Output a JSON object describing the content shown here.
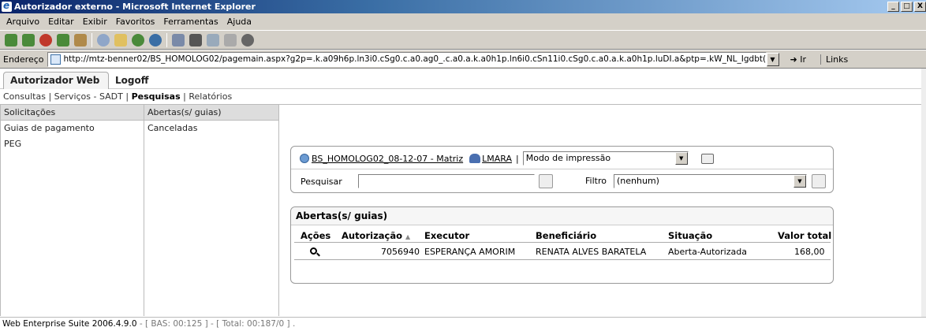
{
  "window": {
    "title": "Autorizador externo - Microsoft Internet Explorer",
    "buttons": [
      "_",
      "□",
      "X"
    ]
  },
  "menu": [
    "Arquivo",
    "Editar",
    "Exibir",
    "Favoritos",
    "Ferramentas",
    "Ajuda"
  ],
  "address": {
    "label": "Endereço",
    "url": "http://mtz-benner02/BS_HOMOLOG02/pagemain.aspx?g2p=.k.a09h6p.ln3i0.cSg0.c.a0.ag0_.c.a0.a.k.a0h1p.ln6i0.cSn11i0.cSg0.c.a0.a.k.a0h1p.luDI.a&ptp=.kW_NL_Igdbt(",
    "go": "Ir",
    "links": "Links"
  },
  "tabs": {
    "active": "Autorizador Web",
    "logoff": "Logoff"
  },
  "subnav": {
    "items": [
      "Consultas",
      "Serviços - SADT",
      "Pesquisas",
      "Relatórios"
    ],
    "sep": "|"
  },
  "nav1": [
    "Solicitações",
    "Guias de pagamento",
    "PEG"
  ],
  "nav2": [
    "Abertas(s/ guias)",
    "Canceladas"
  ],
  "filters": {
    "server_link": "BS_HOMOLOG02_08-12-07 - Matriz",
    "user_link": "LMARA",
    "sep": "|",
    "print_mode": "Modo de impressão",
    "search_label": "Pesquisar",
    "search_value": "",
    "filter_label": "Filtro",
    "filter_value": "(nenhum)"
  },
  "results": {
    "title": "Abertas(s/ guias)",
    "columns": [
      "Ações",
      "Autorização",
      "Executor",
      "Beneficiário",
      "Situação",
      "Valor total"
    ],
    "sort_indicator": "▲",
    "rows": [
      {
        "autorizacao": "7056940",
        "executor": "ESPERANÇA AMORIM",
        "beneficiario": "RENATA ALVES BARATELA",
        "situacao": "Aberta-Autorizada",
        "valor": "168,00"
      }
    ]
  },
  "status": {
    "suite": "Web Enterprise Suite 2006.4.9.0",
    "timing": " - [ BAS: 00:125 ] - [ Total: 00:187/0 ] ."
  }
}
